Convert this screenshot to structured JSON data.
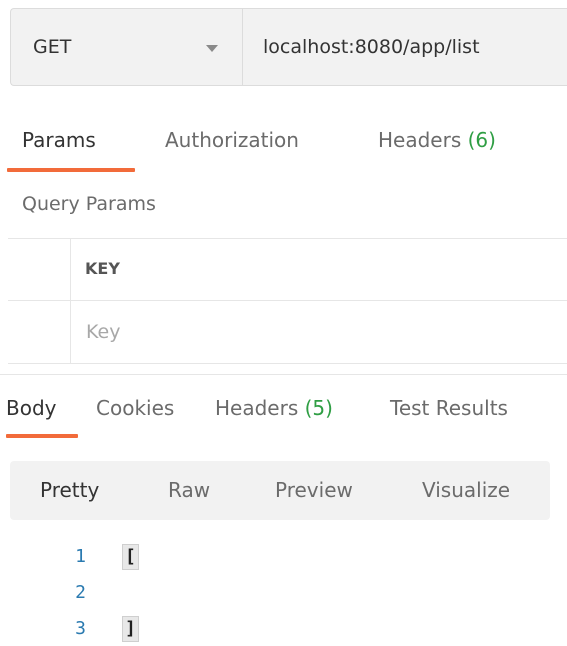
{
  "request": {
    "method": "GET",
    "url": "localhost:8080/app/list"
  },
  "request_tabs": [
    {
      "label": "Params",
      "active": true
    },
    {
      "label": "Authorization",
      "active": false
    },
    {
      "label": "Headers",
      "count": "(6)",
      "active": false
    }
  ],
  "query_params": {
    "title": "Query Params",
    "key_header": "KEY",
    "key_placeholder": "Key"
  },
  "response_tabs": [
    {
      "label": "Body",
      "active": true
    },
    {
      "label": "Cookies",
      "active": false
    },
    {
      "label": "Headers",
      "count": "(5)",
      "active": false
    },
    {
      "label": "Test Results",
      "active": false
    }
  ],
  "view_modes": [
    {
      "label": "Pretty",
      "active": true
    },
    {
      "label": "Raw",
      "active": false
    },
    {
      "label": "Preview",
      "active": false
    },
    {
      "label": "Visualize",
      "active": false
    }
  ],
  "response_body": [
    {
      "line": "1",
      "text": "["
    },
    {
      "line": "2",
      "text": ""
    },
    {
      "line": "3",
      "text": "]"
    }
  ],
  "colors": {
    "accent": "#f26b3a",
    "count": "#2f9e44",
    "line_number": "#2a7ab0"
  },
  "icons": {
    "method_dropdown": "chevron-down-icon"
  }
}
